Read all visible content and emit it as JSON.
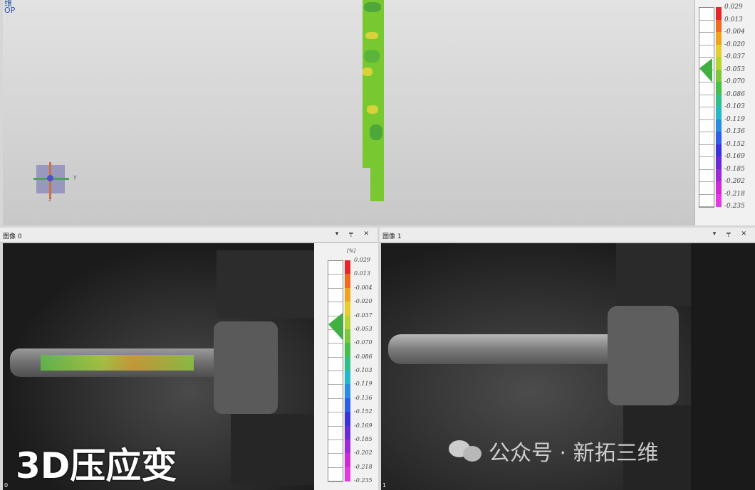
{
  "top_view": {
    "logo_line1": "维",
    "logo_line2": "OP",
    "axis_labels": {
      "y": "y",
      "z": "z"
    },
    "colors": {
      "specimen": "#78c832",
      "patch_yellow": "#d8d23a",
      "patch_green": "#4fa73a"
    }
  },
  "legend": {
    "unit": "[%]",
    "ticks": [
      "0.029",
      "0.013",
      "-0.004",
      "-0.020",
      "-0.037",
      "-0.053",
      "-0.070",
      "-0.086",
      "-0.103",
      "-0.119",
      "-0.136",
      "-0.152",
      "-0.169",
      "-0.185",
      "-0.202",
      "-0.218",
      "-0.235"
    ],
    "colorbar": [
      "#e8262a",
      "#f06a1e",
      "#f0a21c",
      "#e6cf2a",
      "#b8d432",
      "#7cc83a",
      "#45be4a",
      "#2fc08a",
      "#26b8c8",
      "#2a8ee0",
      "#2d5ee8",
      "#3a32dc",
      "#6a2ad8",
      "#a02ad6",
      "#cf2ad8",
      "#e23ae0"
    ]
  },
  "panels": [
    {
      "title": "图像 0",
      "corner_label": "0",
      "controls": "▾ ╤ ✕"
    },
    {
      "title": "图像 1",
      "corner_label": "1",
      "controls": "▾ ╤ ✕"
    }
  ],
  "caption": "3D压应变",
  "watermark": "公众号 · 新拓三维"
}
